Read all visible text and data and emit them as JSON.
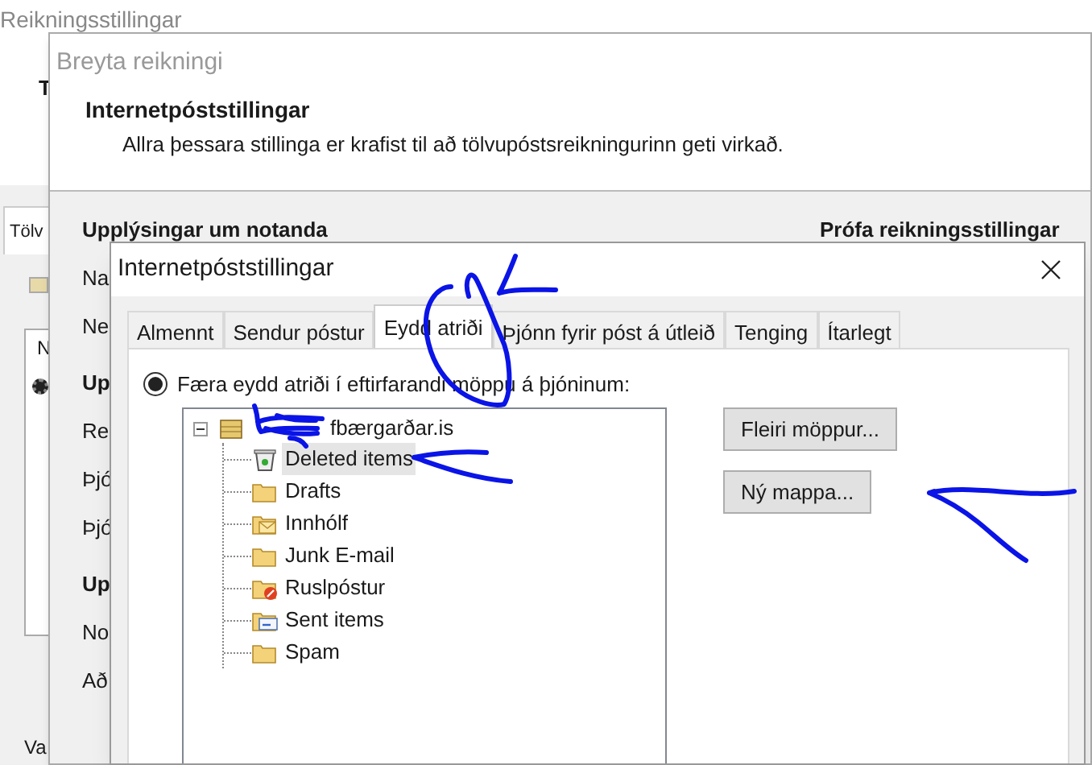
{
  "back_window": {
    "title": "Reikningsstillingar",
    "header_fragment": "T",
    "tab_fragment": "Tölv",
    "list_fragment": "N",
    "footer_fragment": "Va"
  },
  "account_window": {
    "title": "Breyta reikningi",
    "heading": "Internetpóststillingar",
    "description": "Allra þessara stillinga er krafist til að tölvupóstsreikningurinn geti virkað.",
    "labels": [
      {
        "kind": "heading",
        "text": "Upplýsingar um notanda"
      },
      {
        "kind": "field",
        "text": "Na"
      },
      {
        "kind": "field",
        "text": "Ne"
      },
      {
        "kind": "heading",
        "text": "Up"
      },
      {
        "kind": "field",
        "text": "Re"
      },
      {
        "kind": "field",
        "text": "Þjó"
      },
      {
        "kind": "field",
        "text": "Þjó"
      },
      {
        "kind": "heading",
        "text": "Up"
      },
      {
        "kind": "field",
        "text": "No"
      },
      {
        "kind": "field",
        "text": "Að"
      }
    ],
    "right_heading": "Prófa reikningsstillingar"
  },
  "dialog": {
    "title": "Internetpóststillingar",
    "tabs": [
      {
        "label": "Almennt",
        "selected": false
      },
      {
        "label": "Sendur póstur",
        "selected": false
      },
      {
        "label": "Eydd atriði",
        "selected": true
      },
      {
        "label": "Þjónn fyrir póst á útleið",
        "selected": false
      },
      {
        "label": "Tenging",
        "selected": false
      },
      {
        "label": "Ítarlegt",
        "selected": false
      }
    ],
    "radio": {
      "label": "Færa eydd atriði í eftirfarandi möppu á þjóninum:",
      "checked": true
    },
    "tree": {
      "label": "fbærgarðar.is",
      "expanded": true,
      "children": [
        {
          "label": "Deleted items",
          "kind": "trash",
          "selected": true
        },
        {
          "label": "Drafts",
          "kind": "folder",
          "selected": false
        },
        {
          "label": "Innhólf",
          "kind": "inbox",
          "selected": false
        },
        {
          "label": "Junk E-mail",
          "kind": "folder",
          "selected": false
        },
        {
          "label": "Ruslpóstur",
          "kind": "junk",
          "selected": false
        },
        {
          "label": "Sent items",
          "kind": "sent",
          "selected": false
        },
        {
          "label": "Spam",
          "kind": "folder",
          "selected": false
        }
      ]
    },
    "buttons": [
      "Fleiri möppur...",
      "Ný mappa..."
    ]
  }
}
